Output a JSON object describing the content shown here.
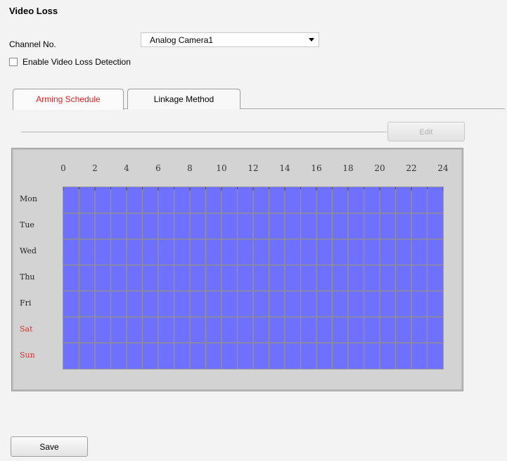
{
  "page": {
    "title": "Video Loss"
  },
  "channel": {
    "label": "Channel No.",
    "selected": "Analog Camera1"
  },
  "detection": {
    "label": "Enable Video Loss Detection",
    "checked": false
  },
  "tabs": [
    {
      "label": "Arming Schedule",
      "active": true
    },
    {
      "label": "Linkage Method",
      "active": false
    }
  ],
  "edit_button": {
    "label": "Edit",
    "enabled": false
  },
  "schedule": {
    "hours": [
      "0",
      "2",
      "4",
      "6",
      "8",
      "10",
      "12",
      "14",
      "16",
      "18",
      "20",
      "22",
      "24"
    ],
    "days": [
      "Mon",
      "Tue",
      "Wed",
      "Thu",
      "Fri",
      "Sat",
      "Sun"
    ],
    "armed_fraction": 1.0,
    "colors": {
      "armed": "#7070ff",
      "weekend": "#e03030"
    }
  },
  "save_button": {
    "label": "Save"
  }
}
